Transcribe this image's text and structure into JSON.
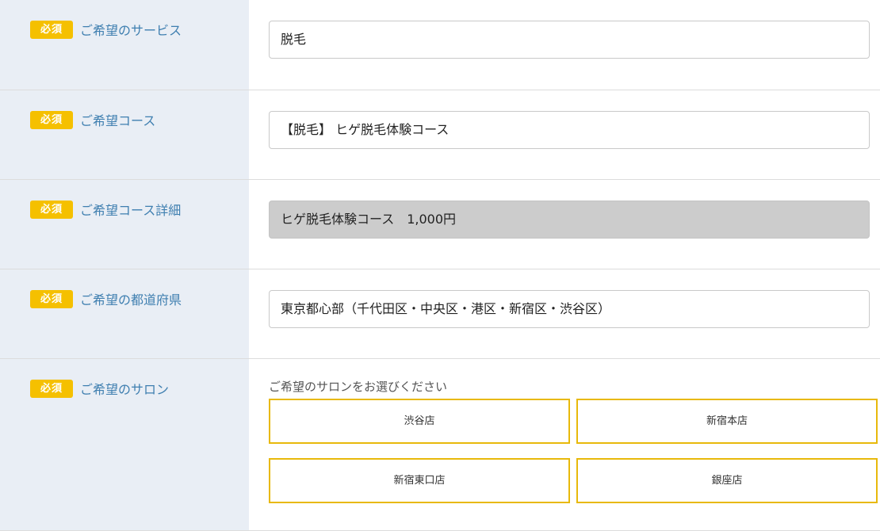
{
  "required_badge": "必須",
  "rows": [
    {
      "label": "ご希望のサービス",
      "value": "脱毛"
    },
    {
      "label": "ご希望コース",
      "value": "【脱毛】 ヒゲ脱毛体験コース"
    },
    {
      "label": "ご希望コース詳細",
      "value": "ヒゲ脱毛体験コース　1,000円"
    },
    {
      "label": "ご希望の都道府県",
      "value": "東京都心部（千代田区・中央区・港区・新宿区・渋谷区）"
    },
    {
      "label": "ご希望のサロン",
      "hint": "ご希望のサロンをお選びください"
    }
  ],
  "salons": [
    "渋谷店",
    "新宿本店",
    "新宿東口店",
    "銀座店"
  ],
  "colors": {
    "badge": "#f5c000",
    "label_text": "#3f7fb0",
    "label_bg": "#e9eef5",
    "salon_border": "#e8b90b",
    "readonly_bg": "#cccccc"
  }
}
